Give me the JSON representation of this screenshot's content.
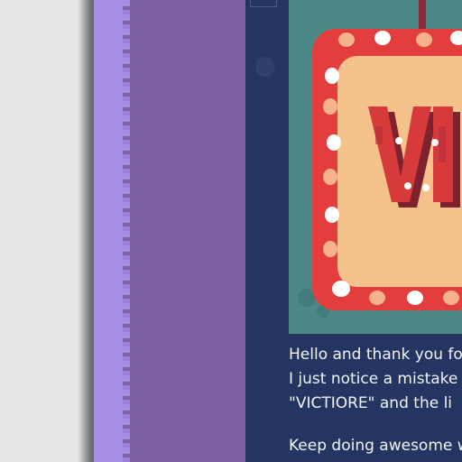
{
  "sign": {
    "letters": "VI",
    "brand_colors": {
      "frame": "#e33d3d",
      "panel": "#f4c28a",
      "letters": "#d63a3a",
      "letters_shadow": "#7e2230",
      "background": "#4b8886",
      "page": "#253562"
    }
  },
  "message": {
    "line1": "Hello and thank you fo",
    "line2": "I just notice a mistake i",
    "line3": "\"VICTIORE\" and the li",
    "line4": "Keep doing awesome w"
  },
  "icons": {
    "corner": "frame-corner-icon",
    "dot": "decorative-dot-icon"
  }
}
